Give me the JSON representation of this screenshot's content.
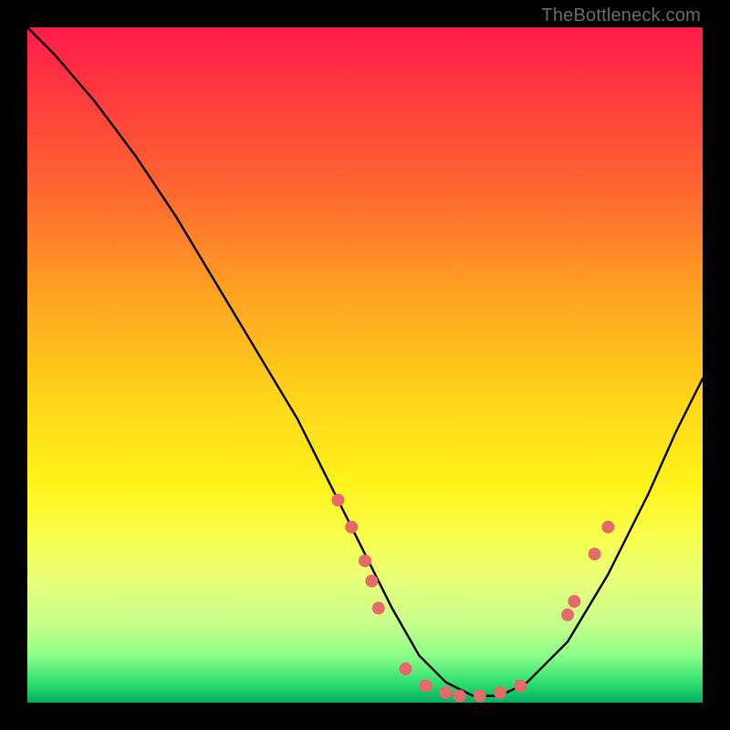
{
  "watermark": "TheBottleneck.com",
  "chart_data": {
    "type": "line",
    "title": "",
    "xlabel": "",
    "ylabel": "",
    "xlim": [
      0,
      100
    ],
    "ylim": [
      0,
      100
    ],
    "series": [
      {
        "name": "bottleneck-curve",
        "x": [
          0,
          4,
          10,
          16,
          22,
          28,
          34,
          40,
          46,
          50,
          54,
          58,
          62,
          66,
          70,
          74,
          80,
          86,
          92,
          96,
          100
        ],
        "y": [
          100,
          96,
          89,
          81,
          72,
          62,
          52,
          42,
          30,
          22,
          14,
          7,
          3,
          1,
          1,
          3,
          9,
          19,
          31,
          40,
          48
        ]
      }
    ],
    "markers": {
      "name": "recommended-range-dots",
      "color": "#e56a6a",
      "radius": 7,
      "points": [
        {
          "x": 46,
          "y": 30
        },
        {
          "x": 48,
          "y": 26
        },
        {
          "x": 50,
          "y": 21
        },
        {
          "x": 51,
          "y": 18
        },
        {
          "x": 52,
          "y": 14
        },
        {
          "x": 56,
          "y": 5
        },
        {
          "x": 59,
          "y": 2.5
        },
        {
          "x": 62,
          "y": 1.5
        },
        {
          "x": 64,
          "y": 1
        },
        {
          "x": 67,
          "y": 1
        },
        {
          "x": 70,
          "y": 1.5
        },
        {
          "x": 73,
          "y": 2.5
        },
        {
          "x": 80,
          "y": 13
        },
        {
          "x": 81,
          "y": 15
        },
        {
          "x": 84,
          "y": 22
        },
        {
          "x": 86,
          "y": 26
        }
      ]
    }
  }
}
